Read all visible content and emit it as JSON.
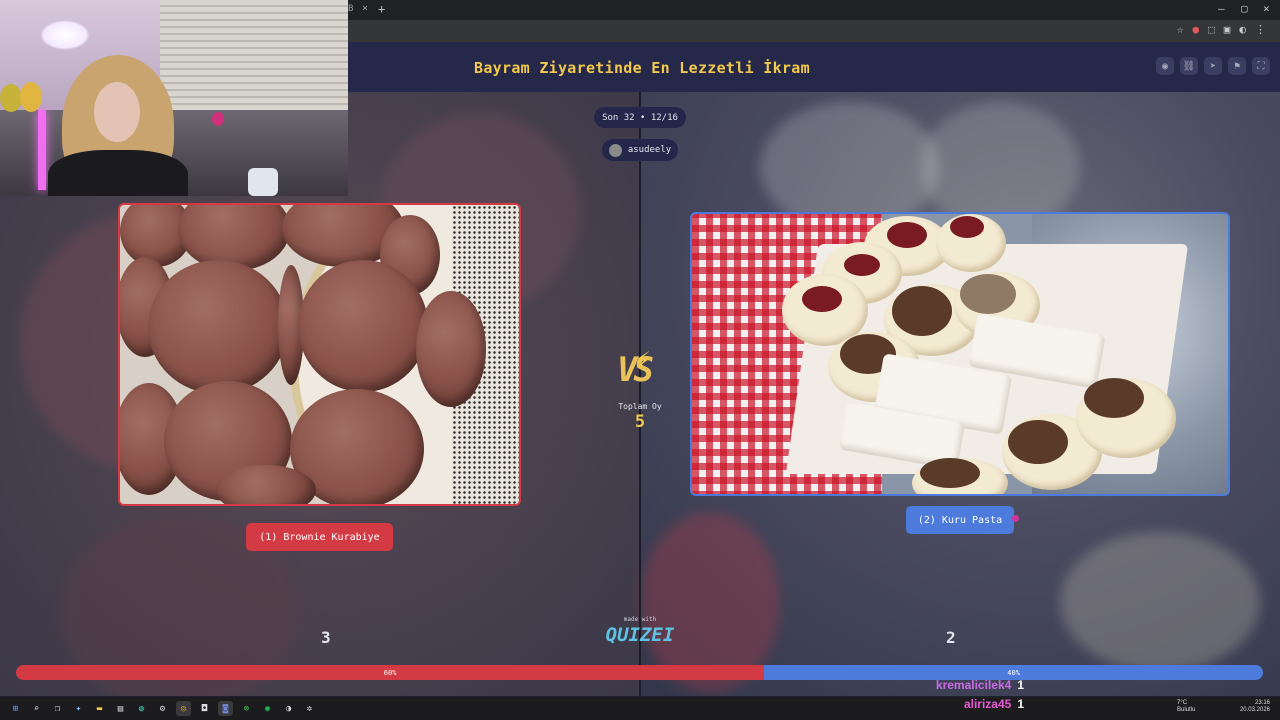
{
  "browser": {
    "tab_fragment": "B",
    "tab_close": "×",
    "new_tab": "+",
    "window_controls": [
      "–",
      "▢",
      "×"
    ],
    "toolbar_icons": [
      "star-icon",
      "extension-icon",
      "download-icon",
      "menu-icon"
    ]
  },
  "app": {
    "title": "Bayram Ziyaretinde En Lezzetli İkram",
    "header_icons": [
      "eye-icon",
      "link-icon",
      "send-icon",
      "flag-icon",
      "fullscreen-icon"
    ]
  },
  "round": {
    "label": "Son 32 • 12/16"
  },
  "creator": {
    "username": "asudeely"
  },
  "versus": {
    "vs_text": "VS",
    "total_label": "Toplam Oy",
    "total_value": "5"
  },
  "left": {
    "choice_label": "(1) Brownie Kurabiye",
    "votes": "3",
    "percent_label": "60%",
    "percent": 60,
    "color": "#d33a44"
  },
  "right": {
    "choice_label": "(2) Kuru Pasta",
    "votes": "2",
    "percent_label": "40%",
    "percent": 40,
    "color": "#4d7bdc"
  },
  "branding": {
    "made_with": "made with",
    "logo": "QUIZEI"
  },
  "chat": [
    {
      "name": "kremalicilek4",
      "count": "1",
      "color": "#c86ce6"
    },
    {
      "name": "aliriza45",
      "count": "1",
      "color": "#e65ad2"
    }
  ],
  "taskbar": {
    "icons": [
      "windows-icon",
      "search-icon",
      "taskview-icon",
      "copilot-icon",
      "explorer-icon",
      "store-icon",
      "edge-icon",
      "settings-icon",
      "chrome-icon",
      "camera-icon",
      "discord-icon",
      "xbox-icon",
      "spotify-icon",
      "steam-icon",
      "gear-icon"
    ],
    "weather_temp": "7°C",
    "weather_desc": "Bulutlu",
    "time": "23:16",
    "date": "20.03.2026"
  }
}
